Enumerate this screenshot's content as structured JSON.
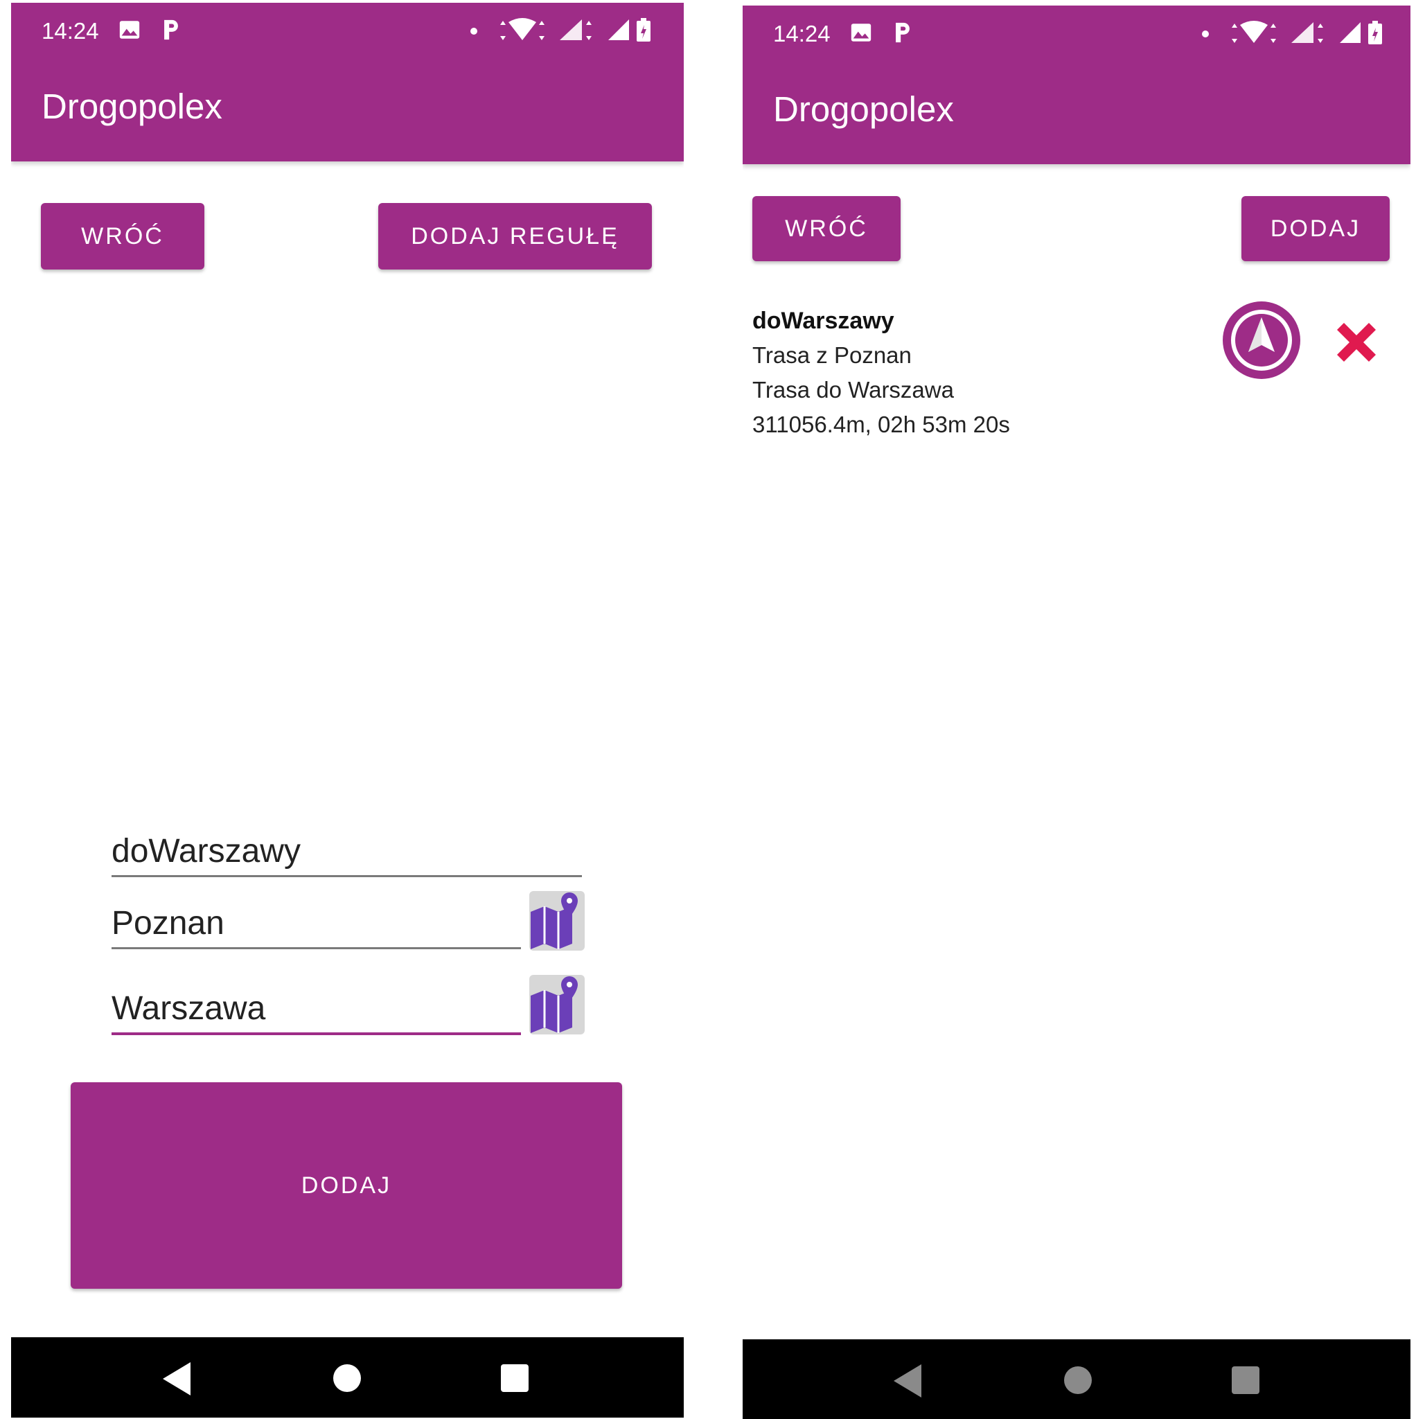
{
  "left_screen": {
    "status": {
      "time": "14:24"
    },
    "app_title": "Drogopolex",
    "back_button": "WRÓĆ",
    "add_rule_button": "DODAJ REGUŁĘ",
    "form": {
      "name_value": "doWarszawy",
      "from_value": "Poznan",
      "to_value": "Warszawa"
    },
    "submit_button": "DODAJ"
  },
  "right_screen": {
    "status": {
      "time": "14:24"
    },
    "app_title": "Drogopolex",
    "back_button": "WRÓĆ",
    "add_button": "DODAJ",
    "routes": [
      {
        "name": "doWarszawy",
        "from": "Trasa z Poznan",
        "to": "Trasa do Warszawa",
        "stats": "311056.4m, 02h 53m 20s"
      }
    ]
  },
  "colors": {
    "primary": "#9e2c87",
    "map_icon": "#6b3fb8",
    "delete": "#e01a4f",
    "nav_bar": "#000000"
  },
  "icons": [
    "image-icon",
    "parking-icon",
    "dot-icon",
    "wifi-icon",
    "signal-icon",
    "battery-icon",
    "map-pin-icon",
    "navigation-icon",
    "close-icon"
  ]
}
